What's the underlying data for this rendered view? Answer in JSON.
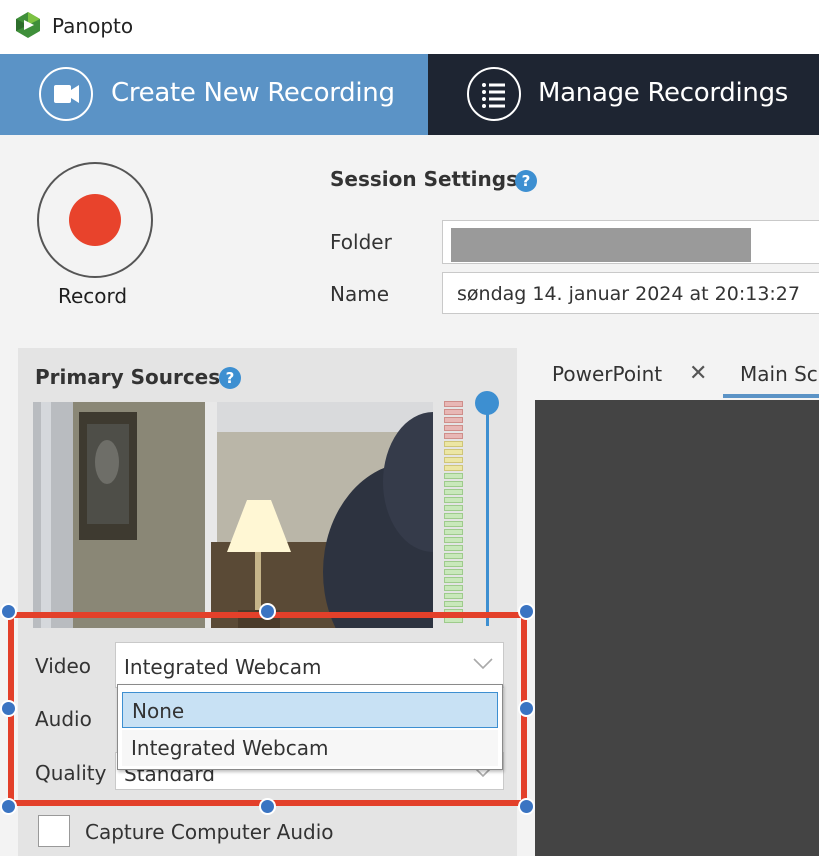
{
  "window": {
    "title": "Panopto"
  },
  "nav": {
    "create_label": "Create New Recording",
    "manage_label": "Manage Recordings"
  },
  "record": {
    "label": "Record"
  },
  "session": {
    "title": "Session Settings",
    "folder_label": "Folder",
    "folder_value": "",
    "name_label": "Name",
    "name_value": "søndag 14. januar 2024 at 20:13:27"
  },
  "primary_sources": {
    "title": "Primary Sources",
    "video_label": "Video",
    "video_value": "Integrated Webcam",
    "audio_label": "Audio",
    "quality_label": "Quality",
    "quality_value": "Standard",
    "video_options": [
      "None",
      "Integrated Webcam"
    ],
    "highlighted_option": "None",
    "capture_audio_label": "Capture Computer Audio",
    "capture_audio_checked": false
  },
  "tabs": [
    {
      "label": "PowerPoint",
      "closable": true
    },
    {
      "label": "Main Sc",
      "selected": true
    }
  ],
  "colors": {
    "accent": "#5b93c6",
    "nav_dark": "#1e2532",
    "record_red": "#e8432c",
    "highlight_red": "#e3402a",
    "handle_blue": "#3a74c2"
  }
}
